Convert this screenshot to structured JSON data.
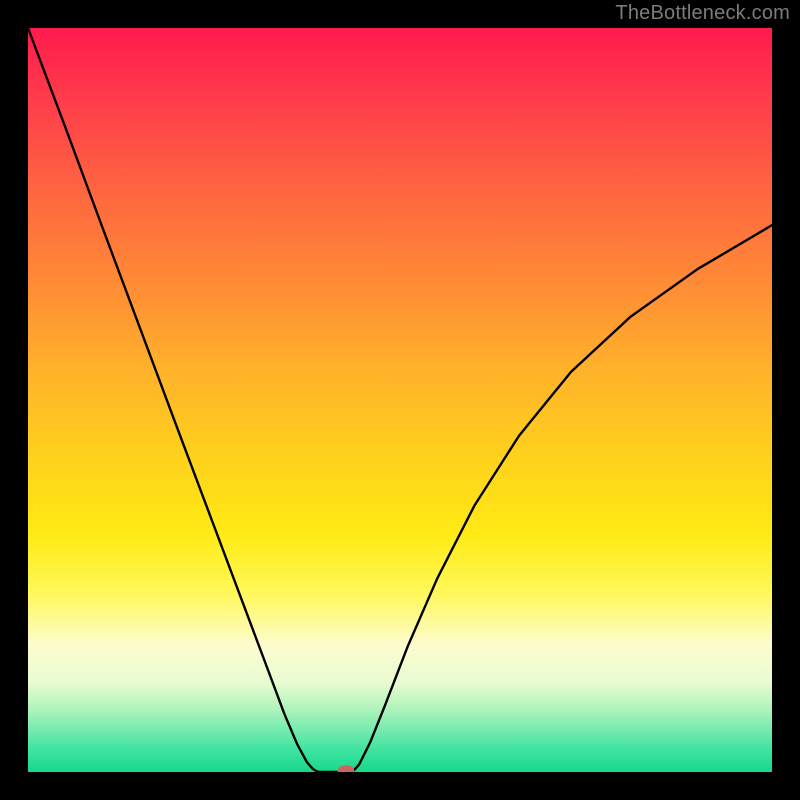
{
  "watermark": "TheBottleneck.com",
  "chart_data": {
    "type": "line",
    "title": "",
    "xlabel": "",
    "ylabel": "",
    "xlim": [
      0,
      1
    ],
    "ylim": [
      0,
      1
    ],
    "grid": false,
    "legend": false,
    "background_gradient": {
      "direction": "vertical",
      "stops": [
        {
          "pos": 0.0,
          "color": "#ff1a4d"
        },
        {
          "pos": 0.22,
          "color": "#ff6640"
        },
        {
          "pos": 0.46,
          "color": "#ffb22a"
        },
        {
          "pos": 0.68,
          "color": "#ffea14"
        },
        {
          "pos": 0.83,
          "color": "#fdfccf"
        },
        {
          "pos": 0.94,
          "color": "#7cecb0"
        },
        {
          "pos": 1.0,
          "color": "#16d98a"
        }
      ]
    },
    "series": [
      {
        "name": "left-branch",
        "x": [
          0.0,
          0.05,
          0.1,
          0.15,
          0.2,
          0.245,
          0.29,
          0.32,
          0.345,
          0.362,
          0.375,
          0.383,
          0.388,
          0.392
        ],
        "y": [
          1.0,
          0.867,
          0.732,
          0.598,
          0.464,
          0.344,
          0.224,
          0.144,
          0.077,
          0.037,
          0.013,
          0.004,
          0.001,
          0.0
        ]
      },
      {
        "name": "flat-valley",
        "x": [
          0.392,
          0.4,
          0.41,
          0.42,
          0.43,
          0.436
        ],
        "y": [
          0.0,
          0.0,
          0.0,
          0.0,
          0.0,
          0.0
        ]
      },
      {
        "name": "right-branch",
        "x": [
          0.436,
          0.445,
          0.46,
          0.48,
          0.51,
          0.55,
          0.6,
          0.66,
          0.73,
          0.81,
          0.9,
          1.0
        ],
        "y": [
          0.0,
          0.01,
          0.04,
          0.09,
          0.168,
          0.26,
          0.358,
          0.452,
          0.538,
          0.612,
          0.676,
          0.735
        ]
      }
    ],
    "marker": {
      "x": 0.428,
      "y": 0.0,
      "color": "#c9655e",
      "shape": "rounded-rect"
    }
  },
  "plot_geometry": {
    "inner_size": 744,
    "margin": 28
  }
}
